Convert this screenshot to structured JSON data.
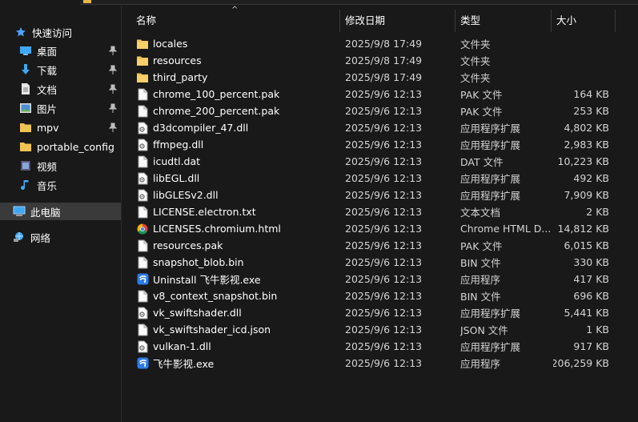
{
  "sidebar": {
    "quick_access": "快速访问",
    "items": [
      {
        "label": "桌面",
        "icon": "desktop-icon",
        "pinned": true
      },
      {
        "label": "下载",
        "icon": "download-icon",
        "pinned": true
      },
      {
        "label": "文档",
        "icon": "document-icon",
        "pinned": true
      },
      {
        "label": "图片",
        "icon": "picture-icon",
        "pinned": true
      },
      {
        "label": "mpv",
        "icon": "folder-icon",
        "pinned": true
      },
      {
        "label": "portable_config",
        "icon": "folder-icon",
        "pinned": false
      },
      {
        "label": "视频",
        "icon": "video-icon",
        "pinned": false
      },
      {
        "label": "音乐",
        "icon": "music-icon",
        "pinned": false
      }
    ],
    "this_pc": "此电脑",
    "network": "网络"
  },
  "columns": {
    "name": "名称",
    "date": "修改日期",
    "type": "类型",
    "size": "大小"
  },
  "files": [
    {
      "name": "locales",
      "date": "2025/9/8 17:49",
      "type": "文件夹",
      "size": "",
      "icon": "folder-icon"
    },
    {
      "name": "resources",
      "date": "2025/9/8 17:49",
      "type": "文件夹",
      "size": "",
      "icon": "folder-icon"
    },
    {
      "name": "third_party",
      "date": "2025/9/8 17:49",
      "type": "文件夹",
      "size": "",
      "icon": "folder-icon"
    },
    {
      "name": "chrome_100_percent.pak",
      "date": "2025/9/6 12:13",
      "type": "PAK 文件",
      "size": "164 KB",
      "icon": "file-icon"
    },
    {
      "name": "chrome_200_percent.pak",
      "date": "2025/9/6 12:13",
      "type": "PAK 文件",
      "size": "253 KB",
      "icon": "file-icon"
    },
    {
      "name": "d3dcompiler_47.dll",
      "date": "2025/9/6 12:13",
      "type": "应用程序扩展",
      "size": "4,802 KB",
      "icon": "dll-icon"
    },
    {
      "name": "ffmpeg.dll",
      "date": "2025/9/6 12:13",
      "type": "应用程序扩展",
      "size": "2,983 KB",
      "icon": "dll-icon"
    },
    {
      "name": "icudtl.dat",
      "date": "2025/9/6 12:13",
      "type": "DAT 文件",
      "size": "10,223 KB",
      "icon": "file-icon"
    },
    {
      "name": "libEGL.dll",
      "date": "2025/9/6 12:13",
      "type": "应用程序扩展",
      "size": "492 KB",
      "icon": "dll-icon"
    },
    {
      "name": "libGLESv2.dll",
      "date": "2025/9/6 12:13",
      "type": "应用程序扩展",
      "size": "7,909 KB",
      "icon": "dll-icon"
    },
    {
      "name": "LICENSE.electron.txt",
      "date": "2025/9/6 12:13",
      "type": "文本文档",
      "size": "2 KB",
      "icon": "file-icon"
    },
    {
      "name": "LICENSES.chromium.html",
      "date": "2025/9/6 12:13",
      "type": "Chrome HTML D...",
      "size": "14,812 KB",
      "icon": "chrome-icon"
    },
    {
      "name": "resources.pak",
      "date": "2025/9/6 12:13",
      "type": "PAK 文件",
      "size": "6,015 KB",
      "icon": "file-icon"
    },
    {
      "name": "snapshot_blob.bin",
      "date": "2025/9/6 12:13",
      "type": "BIN 文件",
      "size": "330 KB",
      "icon": "file-icon"
    },
    {
      "name": "Uninstall 飞牛影视.exe",
      "date": "2025/9/6 12:13",
      "type": "应用程序",
      "size": "417 KB",
      "icon": "app-icon"
    },
    {
      "name": "v8_context_snapshot.bin",
      "date": "2025/9/6 12:13",
      "type": "BIN 文件",
      "size": "696 KB",
      "icon": "file-icon"
    },
    {
      "name": "vk_swiftshader.dll",
      "date": "2025/9/6 12:13",
      "type": "应用程序扩展",
      "size": "5,441 KB",
      "icon": "dll-icon"
    },
    {
      "name": "vk_swiftshader_icd.json",
      "date": "2025/9/6 12:13",
      "type": "JSON 文件",
      "size": "1 KB",
      "icon": "file-icon"
    },
    {
      "name": "vulkan-1.dll",
      "date": "2025/9/6 12:13",
      "type": "应用程序扩展",
      "size": "917 KB",
      "icon": "dll-icon"
    },
    {
      "name": "飞牛影视.exe",
      "date": "2025/9/6 12:13",
      "type": "应用程序",
      "size": "206,259 KB",
      "icon": "app-icon"
    }
  ]
}
